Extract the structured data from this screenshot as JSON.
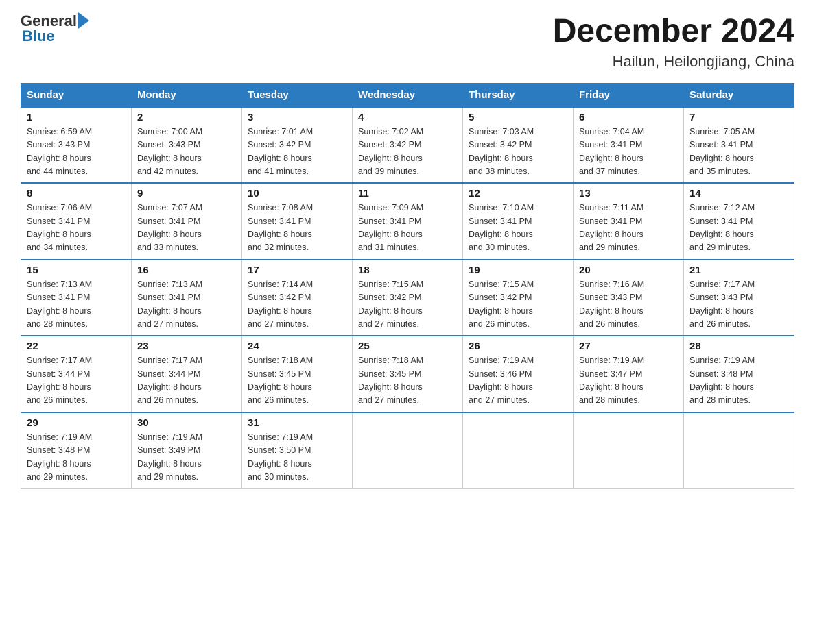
{
  "header": {
    "logo_general": "General",
    "logo_blue": "Blue",
    "calendar_title": "December 2024",
    "calendar_subtitle": "Hailun, Heilongjiang, China"
  },
  "weekdays": [
    "Sunday",
    "Monday",
    "Tuesday",
    "Wednesday",
    "Thursday",
    "Friday",
    "Saturday"
  ],
  "weeks": [
    [
      {
        "day": "1",
        "sunrise": "6:59 AM",
        "sunset": "3:43 PM",
        "daylight": "8 hours and 44 minutes."
      },
      {
        "day": "2",
        "sunrise": "7:00 AM",
        "sunset": "3:43 PM",
        "daylight": "8 hours and 42 minutes."
      },
      {
        "day": "3",
        "sunrise": "7:01 AM",
        "sunset": "3:42 PM",
        "daylight": "8 hours and 41 minutes."
      },
      {
        "day": "4",
        "sunrise": "7:02 AM",
        "sunset": "3:42 PM",
        "daylight": "8 hours and 39 minutes."
      },
      {
        "day": "5",
        "sunrise": "7:03 AM",
        "sunset": "3:42 PM",
        "daylight": "8 hours and 38 minutes."
      },
      {
        "day": "6",
        "sunrise": "7:04 AM",
        "sunset": "3:41 PM",
        "daylight": "8 hours and 37 minutes."
      },
      {
        "day": "7",
        "sunrise": "7:05 AM",
        "sunset": "3:41 PM",
        "daylight": "8 hours and 35 minutes."
      }
    ],
    [
      {
        "day": "8",
        "sunrise": "7:06 AM",
        "sunset": "3:41 PM",
        "daylight": "8 hours and 34 minutes."
      },
      {
        "day": "9",
        "sunrise": "7:07 AM",
        "sunset": "3:41 PM",
        "daylight": "8 hours and 33 minutes."
      },
      {
        "day": "10",
        "sunrise": "7:08 AM",
        "sunset": "3:41 PM",
        "daylight": "8 hours and 32 minutes."
      },
      {
        "day": "11",
        "sunrise": "7:09 AM",
        "sunset": "3:41 PM",
        "daylight": "8 hours and 31 minutes."
      },
      {
        "day": "12",
        "sunrise": "7:10 AM",
        "sunset": "3:41 PM",
        "daylight": "8 hours and 30 minutes."
      },
      {
        "day": "13",
        "sunrise": "7:11 AM",
        "sunset": "3:41 PM",
        "daylight": "8 hours and 29 minutes."
      },
      {
        "day": "14",
        "sunrise": "7:12 AM",
        "sunset": "3:41 PM",
        "daylight": "8 hours and 29 minutes."
      }
    ],
    [
      {
        "day": "15",
        "sunrise": "7:13 AM",
        "sunset": "3:41 PM",
        "daylight": "8 hours and 28 minutes."
      },
      {
        "day": "16",
        "sunrise": "7:13 AM",
        "sunset": "3:41 PM",
        "daylight": "8 hours and 27 minutes."
      },
      {
        "day": "17",
        "sunrise": "7:14 AM",
        "sunset": "3:42 PM",
        "daylight": "8 hours and 27 minutes."
      },
      {
        "day": "18",
        "sunrise": "7:15 AM",
        "sunset": "3:42 PM",
        "daylight": "8 hours and 27 minutes."
      },
      {
        "day": "19",
        "sunrise": "7:15 AM",
        "sunset": "3:42 PM",
        "daylight": "8 hours and 26 minutes."
      },
      {
        "day": "20",
        "sunrise": "7:16 AM",
        "sunset": "3:43 PM",
        "daylight": "8 hours and 26 minutes."
      },
      {
        "day": "21",
        "sunrise": "7:17 AM",
        "sunset": "3:43 PM",
        "daylight": "8 hours and 26 minutes."
      }
    ],
    [
      {
        "day": "22",
        "sunrise": "7:17 AM",
        "sunset": "3:44 PM",
        "daylight": "8 hours and 26 minutes."
      },
      {
        "day": "23",
        "sunrise": "7:17 AM",
        "sunset": "3:44 PM",
        "daylight": "8 hours and 26 minutes."
      },
      {
        "day": "24",
        "sunrise": "7:18 AM",
        "sunset": "3:45 PM",
        "daylight": "8 hours and 26 minutes."
      },
      {
        "day": "25",
        "sunrise": "7:18 AM",
        "sunset": "3:45 PM",
        "daylight": "8 hours and 27 minutes."
      },
      {
        "day": "26",
        "sunrise": "7:19 AM",
        "sunset": "3:46 PM",
        "daylight": "8 hours and 27 minutes."
      },
      {
        "day": "27",
        "sunrise": "7:19 AM",
        "sunset": "3:47 PM",
        "daylight": "8 hours and 28 minutes."
      },
      {
        "day": "28",
        "sunrise": "7:19 AM",
        "sunset": "3:48 PM",
        "daylight": "8 hours and 28 minutes."
      }
    ],
    [
      {
        "day": "29",
        "sunrise": "7:19 AM",
        "sunset": "3:48 PM",
        "daylight": "8 hours and 29 minutes."
      },
      {
        "day": "30",
        "sunrise": "7:19 AM",
        "sunset": "3:49 PM",
        "daylight": "8 hours and 29 minutes."
      },
      {
        "day": "31",
        "sunrise": "7:19 AM",
        "sunset": "3:50 PM",
        "daylight": "8 hours and 30 minutes."
      },
      null,
      null,
      null,
      null
    ]
  ],
  "labels": {
    "sunrise": "Sunrise:",
    "sunset": "Sunset:",
    "daylight": "Daylight:"
  }
}
